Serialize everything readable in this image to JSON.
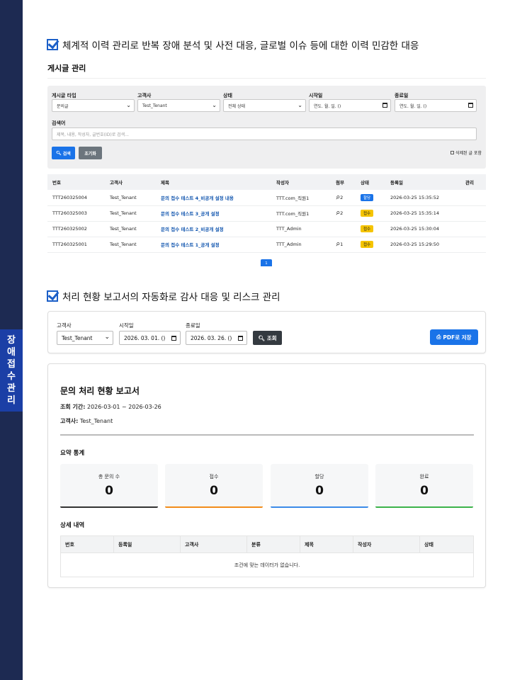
{
  "sidebar": {
    "label_chars": [
      "장",
      "애",
      "접",
      "수",
      "관",
      "리"
    ]
  },
  "section1": {
    "heading": "체계적 이력 관리로 반복 장애 분석 및 사전 대응, 글로벌 이슈 등에 대한 이력 민감한 대응"
  },
  "board": {
    "title": "게시글 관리",
    "filters": {
      "post_type_label": "게시글 타입",
      "post_type_value": "문의글",
      "customer_label": "고객사",
      "customer_value": "Test_Tenant",
      "status_label": "상태",
      "status_value": "전체 상태",
      "start_label": "시작일",
      "start_value": "연도. 월. 일. ()",
      "end_label": "종료일",
      "end_value": "연도. 월. 일. ()",
      "keyword_label": "검색어",
      "keyword_placeholder": "제목, 내용, 작성자, 글번호(ID)로 검색...",
      "search_button": "검색",
      "reset_button": "초기화",
      "include_deleted": "삭제된 글 포함"
    },
    "columns": [
      "번호",
      "고객사",
      "제목",
      "작성자",
      "첨부",
      "상태",
      "등록일",
      "관리"
    ],
    "rows": [
      {
        "id": "TTT260325004",
        "customer": "Test_Tenant",
        "title": "문의 접수 테스트 4_비공개 설정 내용",
        "author": "TTT.com_직원1",
        "attach": "2",
        "status": "할당",
        "status_color": "#1a73e8",
        "date": "2026-03-25 15:35:52"
      },
      {
        "id": "TTT260325003",
        "customer": "Test_Tenant",
        "title": "문의 접수 테스트 3_공개 설정",
        "author": "TTT.com_직원1",
        "attach": "2",
        "status": "접수",
        "status_color": "#f5c400",
        "date": "2026-03-25 15:35:14"
      },
      {
        "id": "TTT260325002",
        "customer": "Test_Tenant",
        "title": "문의 접수 테스트 2_비공개 설정",
        "author": "TTT_Admin",
        "attach": "",
        "status": "접수",
        "status_color": "#f5c400",
        "date": "2026-03-25 15:30:04"
      },
      {
        "id": "TTT260325001",
        "customer": "Test_Tenant",
        "title": "문의 접수 테스트 1_공개 설정",
        "author": "TTT_Admin",
        "attach": "1",
        "status": "접수",
        "status_color": "#f5c400",
        "date": "2026-03-25 15:29:50"
      }
    ],
    "page": "1"
  },
  "section2": {
    "heading": "처리 현황 보고서의 자동화로 감사 대응 및 리스크 관리"
  },
  "report_filters": {
    "customer_label": "고객사",
    "customer_value": "Test_Tenant",
    "start_label": "시작일",
    "start_value": "2026. 03. 01. ()",
    "end_label": "종료일",
    "end_value": "2026. 03. 26. ()",
    "query_button": "조회",
    "pdf_button": "PDF로 저장"
  },
  "report": {
    "title": "문의 처리 현황 보고서",
    "period_label": "조회 기간:",
    "period_value": "2026-03-01 ~ 2026-03-26",
    "customer_label": "고객사:",
    "customer_value": "Test_Tenant",
    "summary_title": "요약 통계",
    "stats": [
      {
        "label": "총 문의 수",
        "value": "0",
        "color": "#333333"
      },
      {
        "label": "접수",
        "value": "0",
        "color": "#f28c1a"
      },
      {
        "label": "할당",
        "value": "0",
        "color": "#3b8be8"
      },
      {
        "label": "완료",
        "value": "0",
        "color": "#3cb34a"
      }
    ],
    "detail_title": "상세 내역",
    "detail_columns": [
      "번호",
      "등록일",
      "고객사",
      "분류",
      "제목",
      "작성자",
      "상태"
    ],
    "empty_message": "조건에 맞는 데이터가 없습니다."
  }
}
